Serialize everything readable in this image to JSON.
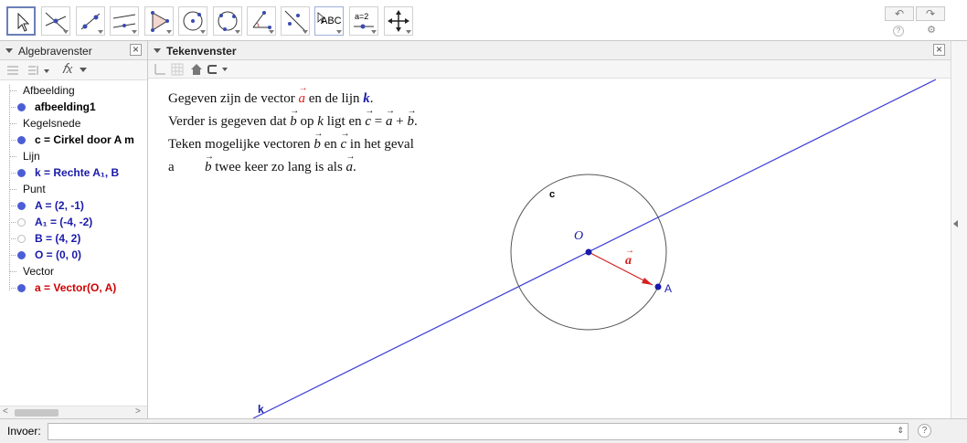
{
  "toolbar": {
    "tools": [
      {
        "name": "move-tool-button",
        "icon": "cursor-arrow-icon"
      },
      {
        "name": "point-tool-button",
        "icon": "intersect-point-icon"
      },
      {
        "name": "line-tool-button",
        "icon": "line-through-points-icon"
      },
      {
        "name": "perpendicular-tool-button",
        "icon": "parallel-lines-icon"
      },
      {
        "name": "polygon-tool-button",
        "icon": "polygon-icon"
      },
      {
        "name": "circle-tool-button",
        "icon": "circle-center-icon"
      },
      {
        "name": "conic-tool-button",
        "icon": "circle-three-points-icon"
      },
      {
        "name": "angle-tool-button",
        "icon": "angle-icon"
      },
      {
        "name": "reflect-tool-button",
        "icon": "reflect-line-icon"
      },
      {
        "name": "text-tool-button",
        "icon": "text-abc-icon",
        "label": "ABC"
      },
      {
        "name": "slider-tool-button",
        "icon": "slider-icon",
        "label": "a=2"
      },
      {
        "name": "move-view-tool-button",
        "icon": "move-arrows-icon"
      }
    ],
    "undo_icon": "↶",
    "redo_icon": "↷",
    "help_icon": "?",
    "settings_icon": "⚙"
  },
  "algebra": {
    "title": "Algebravenster",
    "close": "×",
    "fx": "𝑓x",
    "items": [
      {
        "category": "Afbeelding"
      },
      {
        "label": "afbeelding1",
        "color": "#000000",
        "dot": "filled"
      },
      {
        "category": "Kegelsnede"
      },
      {
        "label": "c = Cirkel door A m",
        "color": "#000000",
        "dot": "filled"
      },
      {
        "category": "Lijn"
      },
      {
        "label": "k = Rechte A₁, B",
        "color": "#1a1aaa",
        "dot": "filled"
      },
      {
        "category": "Punt"
      },
      {
        "label": "A = (2, -1)",
        "color": "#1a1aaa",
        "dot": "filled"
      },
      {
        "label": "A₁ = (-4, -2)",
        "color": "#1a1aaa",
        "dot": "empty"
      },
      {
        "label": "B = (4, 2)",
        "color": "#1a1aaa",
        "dot": "empty"
      },
      {
        "label": "O = (0, 0)",
        "color": "#1a1aaa",
        "dot": "filled"
      },
      {
        "category": "Vector"
      },
      {
        "label": "a = Vector(O, A)",
        "color": "#cc0000",
        "dot": "filled"
      }
    ]
  },
  "graphics": {
    "title": "Tekenvenster",
    "close": "×",
    "text": {
      "line1_a": "Gegeven zijn de vector ",
      "line1_vec": "a",
      "line1_b": " en de lijn ",
      "line1_k": "k",
      "line1_c": ".",
      "line2_a": "Verder is gegeven dat ",
      "line2_vb": "b",
      "line2_b": " op ",
      "line2_k": "k",
      "line2_c": " ligt en ",
      "line2_vc": "c",
      "line2_d": " = ",
      "line2_va": "a",
      "line2_e": " + ",
      "line2_vb2": "b",
      "line2_f": ".",
      "line3_a": "Teken mogelijke vectoren ",
      "line3_vb": "b",
      "line3_b": " en ",
      "line3_vc": "c",
      "line3_c": " in het geval",
      "line4_label": "a",
      "line4_vb": "b",
      "line4_a": " twee keer zo lang is als ",
      "line4_va": "a",
      "line4_b": "."
    },
    "labels": {
      "circle": "c",
      "origin": "O",
      "vector": "a",
      "pointA": "A",
      "line": "k"
    },
    "colors": {
      "line": "#3c3cd8",
      "circle": "#555555",
      "vector": "#d42020",
      "point": "#1a1aaa"
    }
  },
  "input": {
    "label": "Invoer:",
    "value": "",
    "help": "?"
  }
}
